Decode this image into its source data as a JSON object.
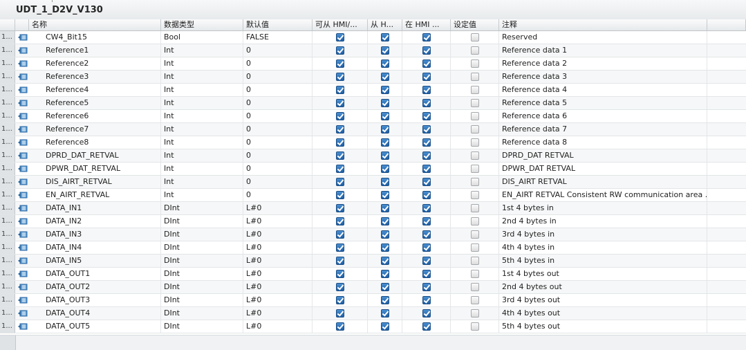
{
  "title": "UDT_1_D2V_V130",
  "columns": [
    "名称",
    "数据类型",
    "默认值",
    "可从 HMI/...",
    "从 H...",
    "在 HMI ...",
    "设定值",
    "注释"
  ],
  "rows": [
    {
      "num": "1...",
      "name": "CW4_Bit15",
      "type": "Bool",
      "default": "FALSE",
      "hmi1": true,
      "hmi2": true,
      "hmi3": true,
      "setpoint": false,
      "comment": "Reserved"
    },
    {
      "num": "1...",
      "name": "Reference1",
      "type": "Int",
      "default": "0",
      "hmi1": true,
      "hmi2": true,
      "hmi3": true,
      "setpoint": false,
      "comment": "Reference data 1"
    },
    {
      "num": "1...",
      "name": "Reference2",
      "type": "Int",
      "default": "0",
      "hmi1": true,
      "hmi2": true,
      "hmi3": true,
      "setpoint": false,
      "comment": "Reference data 2"
    },
    {
      "num": "1...",
      "name": "Reference3",
      "type": "Int",
      "default": "0",
      "hmi1": true,
      "hmi2": true,
      "hmi3": true,
      "setpoint": false,
      "comment": "Reference data 3"
    },
    {
      "num": "1...",
      "name": "Reference4",
      "type": "Int",
      "default": "0",
      "hmi1": true,
      "hmi2": true,
      "hmi3": true,
      "setpoint": false,
      "comment": "Reference data 4"
    },
    {
      "num": "1...",
      "name": "Reference5",
      "type": "Int",
      "default": "0",
      "hmi1": true,
      "hmi2": true,
      "hmi3": true,
      "setpoint": false,
      "comment": "Reference data 5"
    },
    {
      "num": "1...",
      "name": "Reference6",
      "type": "Int",
      "default": "0",
      "hmi1": true,
      "hmi2": true,
      "hmi3": true,
      "setpoint": false,
      "comment": "Reference data 6"
    },
    {
      "num": "1...",
      "name": "Reference7",
      "type": "Int",
      "default": "0",
      "hmi1": true,
      "hmi2": true,
      "hmi3": true,
      "setpoint": false,
      "comment": "Reference data 7"
    },
    {
      "num": "1...",
      "name": "Reference8",
      "type": "Int",
      "default": "0",
      "hmi1": true,
      "hmi2": true,
      "hmi3": true,
      "setpoint": false,
      "comment": "Reference data 8"
    },
    {
      "num": "1...",
      "name": "DPRD_DAT_RETVAL",
      "type": "Int",
      "default": "0",
      "hmi1": true,
      "hmi2": true,
      "hmi3": true,
      "setpoint": false,
      "comment": "DPRD_DAT RETVAL"
    },
    {
      "num": "1...",
      "name": "DPWR_DAT_RETVAL",
      "type": "Int",
      "default": "0",
      "hmi1": true,
      "hmi2": true,
      "hmi3": true,
      "setpoint": false,
      "comment": "DPWR_DAT RETVAL"
    },
    {
      "num": "1...",
      "name": "DIS_AIRT_RETVAL",
      "type": "Int",
      "default": "0",
      "hmi1": true,
      "hmi2": true,
      "hmi3": true,
      "setpoint": false,
      "comment": "DIS_AIRT RETVAL"
    },
    {
      "num": "1...",
      "name": "EN_AIRT_RETVAL",
      "type": "Int",
      "default": "0",
      "hmi1": true,
      "hmi2": true,
      "hmi3": true,
      "setpoint": false,
      "comment": "EN_AIRT RETVAL Consistent RW communication area ..."
    },
    {
      "num": "1...",
      "name": "DATA_IN1",
      "type": "DInt",
      "default": "L#0",
      "hmi1": true,
      "hmi2": true,
      "hmi3": true,
      "setpoint": false,
      "comment": "1st 4 bytes in"
    },
    {
      "num": "1...",
      "name": "DATA_IN2",
      "type": "DInt",
      "default": "L#0",
      "hmi1": true,
      "hmi2": true,
      "hmi3": true,
      "setpoint": false,
      "comment": "2nd 4 bytes in"
    },
    {
      "num": "1...",
      "name": "DATA_IN3",
      "type": "DInt",
      "default": "L#0",
      "hmi1": true,
      "hmi2": true,
      "hmi3": true,
      "setpoint": false,
      "comment": "3rd 4 bytes in"
    },
    {
      "num": "1...",
      "name": "DATA_IN4",
      "type": "DInt",
      "default": "L#0",
      "hmi1": true,
      "hmi2": true,
      "hmi3": true,
      "setpoint": false,
      "comment": "4th 4 bytes in"
    },
    {
      "num": "1...",
      "name": "DATA_IN5",
      "type": "DInt",
      "default": "L#0",
      "hmi1": true,
      "hmi2": true,
      "hmi3": true,
      "setpoint": false,
      "comment": "5th 4 bytes in"
    },
    {
      "num": "1...",
      "name": "DATA_OUT1",
      "type": "DInt",
      "default": "L#0",
      "hmi1": true,
      "hmi2": true,
      "hmi3": true,
      "setpoint": false,
      "comment": "1st 4 bytes out"
    },
    {
      "num": "1...",
      "name": "DATA_OUT2",
      "type": "DInt",
      "default": "L#0",
      "hmi1": true,
      "hmi2": true,
      "hmi3": true,
      "setpoint": false,
      "comment": "2nd 4 bytes out"
    },
    {
      "num": "1...",
      "name": "DATA_OUT3",
      "type": "DInt",
      "default": "L#0",
      "hmi1": true,
      "hmi2": true,
      "hmi3": true,
      "setpoint": false,
      "comment": "3rd 4 bytes out"
    },
    {
      "num": "1...",
      "name": "DATA_OUT4",
      "type": "DInt",
      "default": "L#0",
      "hmi1": true,
      "hmi2": true,
      "hmi3": true,
      "setpoint": false,
      "comment": "4th 4 bytes out"
    },
    {
      "num": "1...",
      "name": "DATA_OUT5",
      "type": "DInt",
      "default": "L#0",
      "hmi1": true,
      "hmi2": true,
      "hmi3": true,
      "setpoint": false,
      "comment": "5th 4 bytes out"
    }
  ],
  "row_icon": "udt-element-icon",
  "colors": {
    "accent": "#1f5fa6",
    "checkbox_checked": "#2f74bd",
    "row_header": "#dfe3e6"
  }
}
